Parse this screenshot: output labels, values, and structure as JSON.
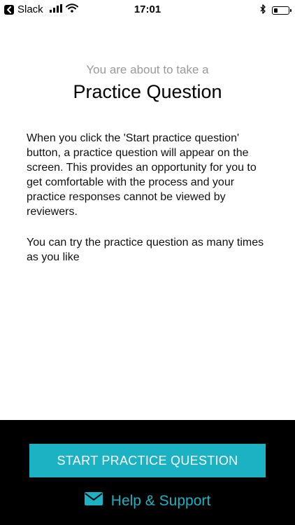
{
  "status_bar": {
    "back_app": "Slack",
    "time": "17:01",
    "battery_level": 0.25
  },
  "content": {
    "intro": "You are about to take a",
    "title": "Practice Question",
    "paragraph1": "When you click the 'Start practice question' button, a practice question will appear on the screen. This provides an opportunity for you to get comfortable with the process and your practice responses cannot be viewed by reviewers.",
    "paragraph2": "You can try the practice question as many times as you like"
  },
  "footer": {
    "start_button_label": "START PRACTICE QUESTION",
    "help_label": "Help & Support",
    "help_icon": "envelope-icon"
  },
  "colors": {
    "accent": "#1bb3c3",
    "footer_bg": "#000000",
    "intro_text": "#9a9a9a"
  }
}
